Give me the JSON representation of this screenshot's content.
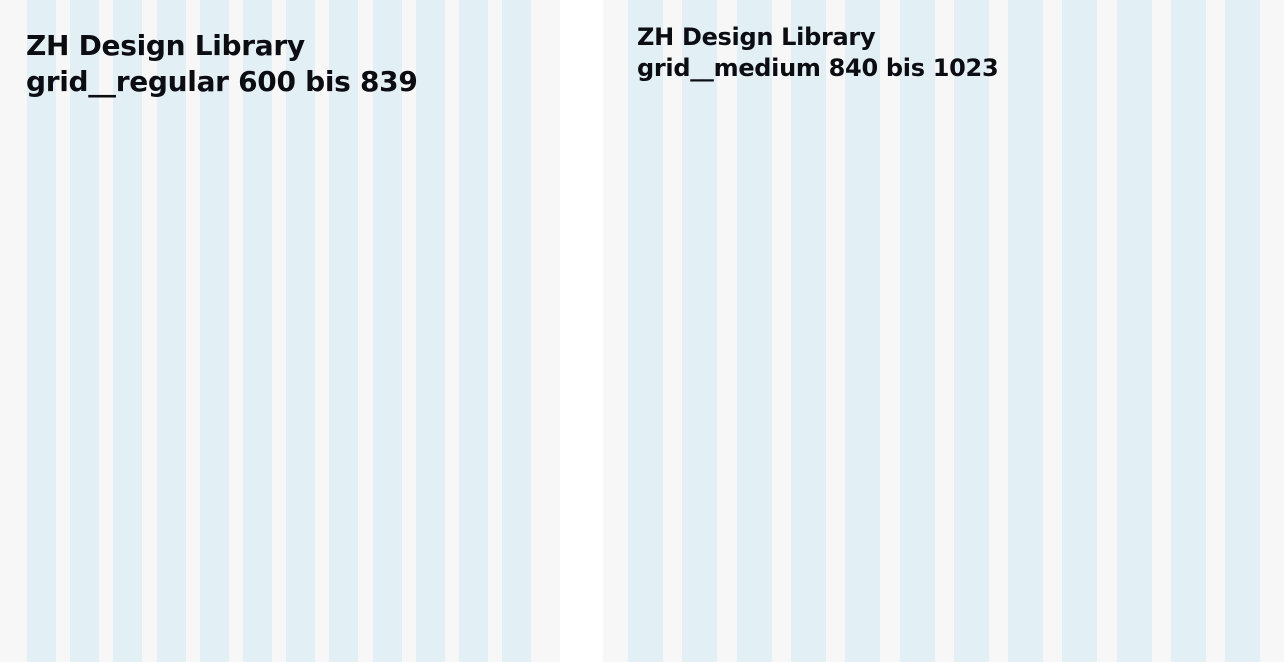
{
  "colors": {
    "frame_background": "#f7f7f7",
    "column_fill": "#e2eff5",
    "title_text": "#0b0d12",
    "gutter_between_frames": "#ffffff"
  },
  "grids": [
    {
      "line1": "ZH Design Library",
      "line2": "grid__regular 600 bis 839",
      "columns": 12
    },
    {
      "line1": "ZH Design Library",
      "line2": "grid__medium 840 bis 1023",
      "columns": 12
    }
  ]
}
